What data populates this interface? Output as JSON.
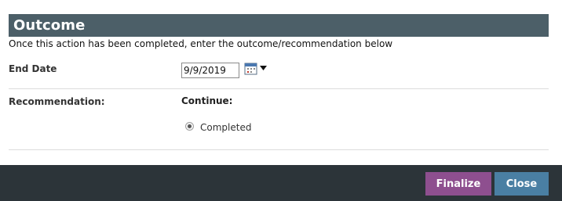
{
  "header": {
    "title": "Outcome"
  },
  "instructions": "Once this action has been completed, enter the outcome/recommendation below",
  "end_date": {
    "label": "End Date",
    "value": "9/9/2019",
    "calendar_icon": "calendar-icon",
    "dropdown_icon": "dropdown-arrow-icon"
  },
  "recommendation": {
    "label": "Recommendation:",
    "group_label": "Continue:",
    "options": [
      {
        "label": "Completed",
        "selected": true
      }
    ]
  },
  "footer": {
    "finalize_label": "Finalize",
    "close_label": "Close",
    "colors": {
      "finalize": "#8e4f8f",
      "close": "#4a7fa3",
      "bar": "#2c3439",
      "header": "#4c5f68"
    }
  }
}
